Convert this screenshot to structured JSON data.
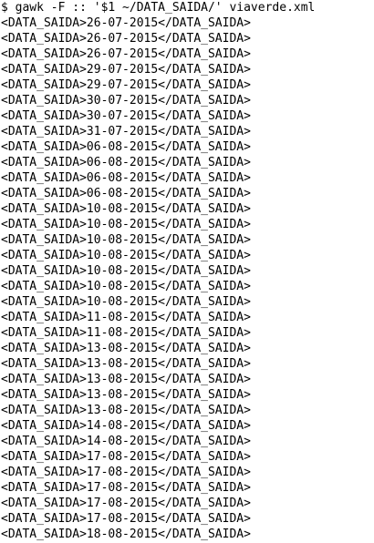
{
  "terminal": {
    "command": "$ gawk -F :: '$1 ~/DATA_SAIDA/' viaverde.xml",
    "lines": [
      "<DATA_SAIDA>26-07-2015</DATA_SAIDA>",
      "<DATA_SAIDA>26-07-2015</DATA_SAIDA>",
      "<DATA_SAIDA>26-07-2015</DATA_SAIDA>",
      "<DATA_SAIDA>29-07-2015</DATA_SAIDA>",
      "<DATA_SAIDA>29-07-2015</DATA_SAIDA>",
      "<DATA_SAIDA>30-07-2015</DATA_SAIDA>",
      "<DATA_SAIDA>30-07-2015</DATA_SAIDA>",
      "<DATA_SAIDA>31-07-2015</DATA_SAIDA>",
      "<DATA_SAIDA>06-08-2015</DATA_SAIDA>",
      "<DATA_SAIDA>06-08-2015</DATA_SAIDA>",
      "<DATA_SAIDA>06-08-2015</DATA_SAIDA>",
      "<DATA_SAIDA>06-08-2015</DATA_SAIDA>",
      "<DATA_SAIDA>10-08-2015</DATA_SAIDA>",
      "<DATA_SAIDA>10-08-2015</DATA_SAIDA>",
      "<DATA_SAIDA>10-08-2015</DATA_SAIDA>",
      "<DATA_SAIDA>10-08-2015</DATA_SAIDA>",
      "<DATA_SAIDA>10-08-2015</DATA_SAIDA>",
      "<DATA_SAIDA>10-08-2015</DATA_SAIDA>",
      "<DATA_SAIDA>10-08-2015</DATA_SAIDA>",
      "<DATA_SAIDA>11-08-2015</DATA_SAIDA>",
      "<DATA_SAIDA>11-08-2015</DATA_SAIDA>",
      "<DATA_SAIDA>13-08-2015</DATA_SAIDA>",
      "<DATA_SAIDA>13-08-2015</DATA_SAIDA>",
      "<DATA_SAIDA>13-08-2015</DATA_SAIDA>",
      "<DATA_SAIDA>13-08-2015</DATA_SAIDA>",
      "<DATA_SAIDA>13-08-2015</DATA_SAIDA>",
      "<DATA_SAIDA>14-08-2015</DATA_SAIDA>",
      "<DATA_SAIDA>14-08-2015</DATA_SAIDA>",
      "<DATA_SAIDA>17-08-2015</DATA_SAIDA>",
      "<DATA_SAIDA>17-08-2015</DATA_SAIDA>",
      "<DATA_SAIDA>17-08-2015</DATA_SAIDA>",
      "<DATA_SAIDA>17-08-2015</DATA_SAIDA>",
      "<DATA_SAIDA>17-08-2015</DATA_SAIDA>",
      "<DATA_SAIDA>18-08-2015</DATA_SAIDA>"
    ]
  }
}
